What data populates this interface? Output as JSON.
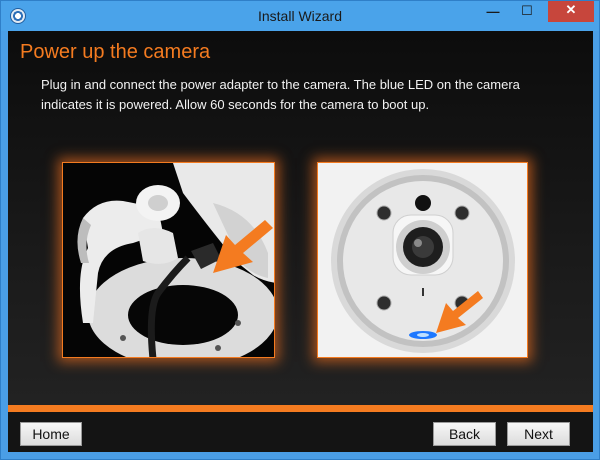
{
  "window": {
    "title": "Install Wizard",
    "controls": {
      "minimize": "—",
      "maximize": "☐",
      "close": "✕"
    }
  },
  "page": {
    "heading": "Power up the camera",
    "description": "Plug in and connect the power adapter to the camera. The blue LED on the camera indicates it is powered. Allow 60 seconds for the camera to boot up."
  },
  "images": {
    "left": "power-adapter-plug-photo",
    "right": "camera-front-blue-led-photo"
  },
  "footer": {
    "home_label": "Home",
    "back_label": "Back",
    "next_label": "Next"
  },
  "colors": {
    "accent": "#f47b20",
    "titlebar": "#4aa3ea",
    "close_button": "#c7463c",
    "led": "#1e78ff"
  }
}
